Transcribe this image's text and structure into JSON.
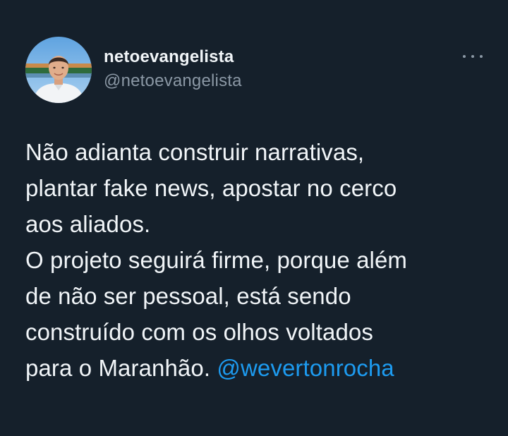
{
  "author": {
    "display_name": "netoevangelista",
    "handle": "@netoevangelista",
    "avatar_icon": "profile-photo-icon"
  },
  "menu": {
    "icon": "more-options-icon"
  },
  "tweet": {
    "lines": [
      "Não adianta construir narrativas,",
      "plantar fake news, apostar no cerco",
      "aos aliados.",
      "O projeto seguirá firme, porque além",
      "de não ser pessoal, está sendo",
      "construído com os olhos voltados",
      "para o Maranhão."
    ],
    "mention": "@wevertonrocha"
  },
  "colors": {
    "background": "#15202b",
    "text": "#f1f5f8",
    "secondary_text": "#8b98a5",
    "link": "#1d9bf0"
  }
}
